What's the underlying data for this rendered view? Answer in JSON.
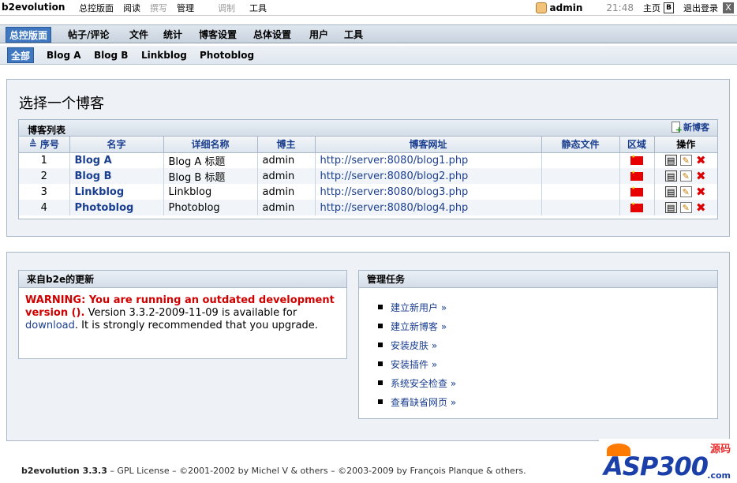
{
  "topbar": {
    "brand": "b2evolution",
    "menu": [
      "总控版面",
      "阅读",
      "撰写",
      "管理",
      "调制",
      "工具"
    ],
    "user": "admin",
    "time": "21:48",
    "home": "主页",
    "b_icon": "B",
    "logout": "退出登录",
    "close": "X"
  },
  "mainnav": [
    "总控版面",
    "帖子/评论",
    "文件",
    "统计",
    "博客设置",
    "总体设置",
    "用户",
    "工具"
  ],
  "subnav": [
    "全部",
    "Blog A",
    "Blog B",
    "Linkblog",
    "Photoblog"
  ],
  "page": {
    "title": "选择一个博客",
    "list_title": "博客列表",
    "new_blog": "新博客",
    "columns": [
      "序号",
      "名字",
      "详细名称",
      "博主",
      "博客网址",
      "静态文件",
      "区域",
      "操作"
    ],
    "sort_icon": "≜",
    "rows": [
      {
        "id": "1",
        "name": "Blog A",
        "fullname": "Blog A 标题",
        "owner": "admin",
        "url": "http://server:8080/blog1.php"
      },
      {
        "id": "2",
        "name": "Blog B",
        "fullname": "Blog B 标题",
        "owner": "admin",
        "url": "http://server:8080/blog2.php"
      },
      {
        "id": "3",
        "name": "Linkblog",
        "fullname": "Linkblog",
        "owner": "admin",
        "url": "http://server:8080/blog3.php"
      },
      {
        "id": "4",
        "name": "Photoblog",
        "fullname": "Photoblog",
        "owner": "admin",
        "url": "http://server:8080/blog4.php"
      }
    ]
  },
  "updates": {
    "title": "来自b2e的更新",
    "warning": "WARNING: You are running an outdated development version ().",
    "text1": " Version 3.3.2-2009-11-09 is available for ",
    "link": "download",
    "text2": ". It is strongly recommended that you upgrade."
  },
  "tasks": {
    "title": "管理任务",
    "items": [
      "建立新用户 »",
      "建立新博客 »",
      "安装皮肤 »",
      "安装插件 »",
      "系统安全检查 »",
      "查看缺省网页 »"
    ]
  },
  "footer": {
    "version": "b2evolution 3.3.3",
    "rest": " – GPL License – ©2001-2002 by Michel V & others – ©2003-2009 by François Planque & others."
  },
  "watermark": {
    "main": "ASP300",
    "cn": "源码",
    "com": ".com"
  },
  "colors": {
    "accent": "#3f78c0",
    "link": "#1b3f8f",
    "warning": "#d00000"
  }
}
